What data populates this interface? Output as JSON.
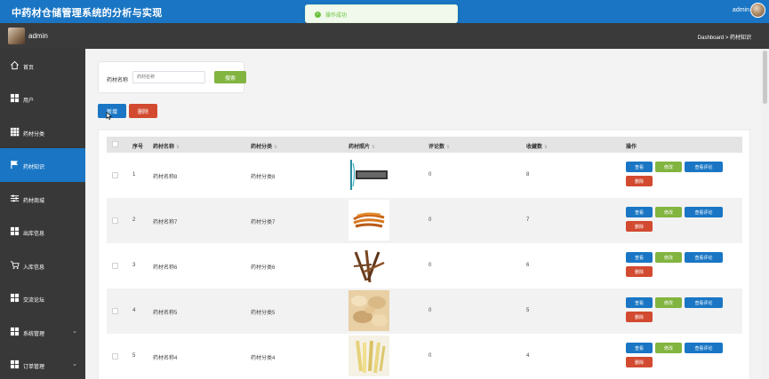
{
  "header": {
    "title": "中药材仓储管理系统的分析与实现",
    "user": "admin"
  },
  "toast": {
    "message": "操作成功"
  },
  "subheader": {
    "username": "admin",
    "breadcrumb": "Dashboard > 药材知识"
  },
  "sidebar": {
    "items": [
      {
        "label": "首页",
        "icon": "home-icon"
      },
      {
        "label": "用户",
        "icon": "grid-icon"
      },
      {
        "label": "药材分类",
        "icon": "grid-icon"
      },
      {
        "label": "药材知识",
        "icon": "flag-icon",
        "active": true
      },
      {
        "label": "药材商城",
        "icon": "sliders-icon"
      },
      {
        "label": "出库信息",
        "icon": "grid-icon"
      },
      {
        "label": "入库信息",
        "icon": "cart-icon"
      },
      {
        "label": "交流论坛",
        "icon": "grid-icon"
      },
      {
        "label": "系统管理",
        "icon": "grid-icon",
        "chevron": "⌄"
      },
      {
        "label": "订单管理",
        "icon": "grid-icon",
        "chevron": "⌄"
      }
    ]
  },
  "search": {
    "label": "药材名称",
    "placeholder": "药材名称",
    "button": "搜索"
  },
  "toolbar": {
    "add": "新增",
    "delete": "删除"
  },
  "table": {
    "headers": [
      "序号",
      "药材名称",
      "药材分类",
      "药材照片",
      "评论数",
      "收藏数",
      "操作"
    ],
    "rows": [
      {
        "index": "1",
        "name": "药材名称8",
        "category": "药材分类8",
        "comments": "0",
        "favorites": "8",
        "photo": "text-logo"
      },
      {
        "index": "2",
        "name": "药材名称7",
        "category": "药材分类7",
        "comments": "0",
        "favorites": "7",
        "photo": "cordyceps"
      },
      {
        "index": "3",
        "name": "药材名称6",
        "category": "药材分类6",
        "comments": "0",
        "favorites": "6",
        "photo": "roots"
      },
      {
        "index": "4",
        "name": "药材名称5",
        "category": "药材分类5",
        "comments": "0",
        "favorites": "5",
        "photo": "slices"
      },
      {
        "index": "5",
        "name": "药材名称4",
        "category": "药材分类4",
        "comments": "0",
        "favorites": "4",
        "photo": "strips"
      }
    ],
    "actions": {
      "view": "查看",
      "edit": "修改",
      "reviews": "查看评论",
      "delete": "删除"
    }
  },
  "colors": {
    "primary": "#1a76c4",
    "success": "#82b440",
    "danger": "#d24a30",
    "sidebar": "#383838"
  }
}
